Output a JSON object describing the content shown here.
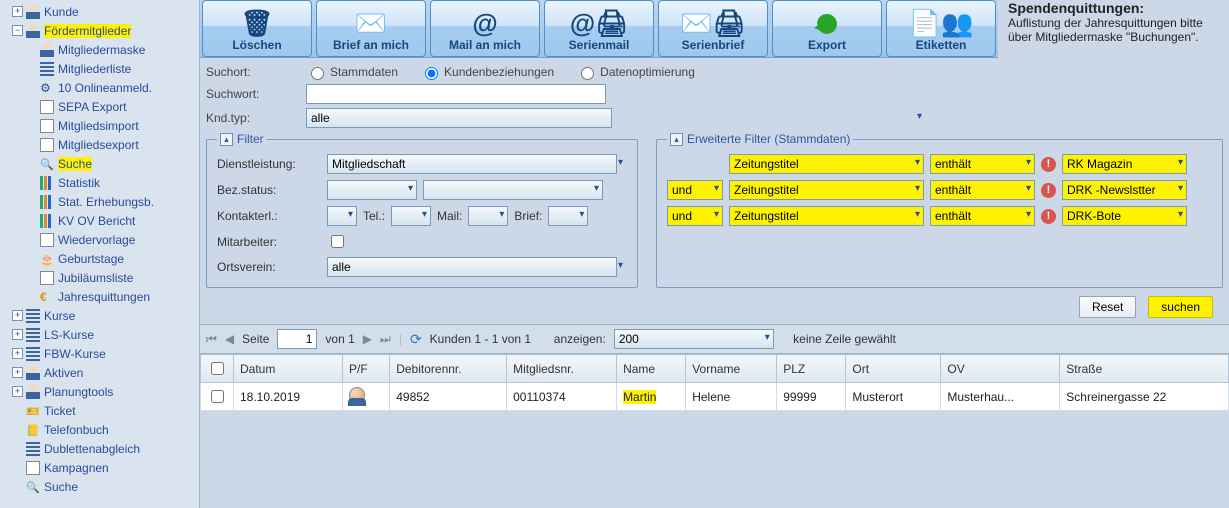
{
  "sidebar": {
    "items": [
      {
        "plus": "+",
        "icon": "person",
        "label": "Kunde",
        "level": 1,
        "name": "kunde"
      },
      {
        "plus": "−",
        "icon": "person",
        "label": "Fördermitglieder",
        "level": 1,
        "hl": true,
        "name": "foerdermitglieder"
      },
      {
        "plus": "",
        "icon": "person",
        "label": "Mitgliedermaske",
        "level": 2,
        "name": "mitgliedermaske"
      },
      {
        "plus": "",
        "icon": "list",
        "label": "Mitgliederliste",
        "level": 2,
        "name": "mitgliederliste"
      },
      {
        "plus": "",
        "icon": "gear",
        "label": "10  Onlineanmeld.",
        "level": 2,
        "name": "onlineanmeld"
      },
      {
        "plus": "",
        "icon": "doc",
        "label": "SEPA Export",
        "level": 2,
        "name": "sepa-export"
      },
      {
        "plus": "",
        "icon": "doc",
        "label": "Mitgliedsimport",
        "level": 2,
        "name": "mitgliedsimport"
      },
      {
        "plus": "",
        "icon": "doc",
        "label": "Mitgliedsexport",
        "level": 2,
        "name": "mitgliedsexport"
      },
      {
        "plus": "",
        "icon": "search",
        "label": "Suche",
        "level": 2,
        "hl": true,
        "name": "suche"
      },
      {
        "plus": "",
        "icon": "bars",
        "label": "Statistik",
        "level": 2,
        "name": "statistik"
      },
      {
        "plus": "",
        "icon": "bars",
        "label": "Stat. Erhebungsb.",
        "level": 2,
        "name": "stat-erhebungsb"
      },
      {
        "plus": "",
        "icon": "bars",
        "label": "KV OV Bericht",
        "level": 2,
        "name": "kv-ov-bericht"
      },
      {
        "plus": "",
        "icon": "doc",
        "label": "Wiedervorlage",
        "level": 2,
        "name": "wiedervorlage"
      },
      {
        "plus": "",
        "icon": "cake",
        "label": "Geburtstage",
        "level": 2,
        "name": "geburtstage"
      },
      {
        "plus": "",
        "icon": "doc",
        "label": "Jubiläumsliste",
        "level": 2,
        "name": "jubilaeumsliste"
      },
      {
        "plus": "",
        "icon": "euro",
        "label": "Jahresquittungen",
        "level": 2,
        "name": "jahresquittungen"
      },
      {
        "plus": "+",
        "icon": "list",
        "label": "Kurse",
        "level": 1,
        "name": "kurse"
      },
      {
        "plus": "+",
        "icon": "list",
        "label": "LS-Kurse",
        "level": 1,
        "name": "ls-kurse"
      },
      {
        "plus": "+",
        "icon": "list",
        "label": "FBW-Kurse",
        "level": 1,
        "name": "fbw-kurse"
      },
      {
        "plus": "+",
        "icon": "person",
        "label": "Aktiven",
        "level": 1,
        "name": "aktiven"
      },
      {
        "plus": "+",
        "icon": "person",
        "label": "Planungtools",
        "level": 1,
        "name": "planungtools"
      },
      {
        "plus": "",
        "icon": "ticket",
        "label": "Ticket",
        "level": 1,
        "name": "ticket"
      },
      {
        "plus": "",
        "icon": "phone",
        "label": "Telefonbuch",
        "level": 1,
        "name": "telefonbuch"
      },
      {
        "plus": "",
        "icon": "list",
        "label": "Dublettenabgleich",
        "level": 1,
        "name": "dublettenabgleich"
      },
      {
        "plus": "",
        "icon": "doc",
        "label": "Kampagnen",
        "level": 1,
        "name": "kampagnen"
      },
      {
        "plus": "",
        "icon": "search",
        "label": "Suche",
        "level": 1,
        "name": "global-suche"
      }
    ]
  },
  "toolbar": {
    "buttons": [
      {
        "label": "Löschen",
        "icon": "🗑",
        "name": "delete"
      },
      {
        "label": "Brief an mich",
        "icon": "✉️",
        "name": "brief-an-mich"
      },
      {
        "label": "Mail an mich",
        "icon": "@",
        "name": "mail-an-mich"
      },
      {
        "label": "Serienmail",
        "icon": "@🖨",
        "name": "serienmail"
      },
      {
        "label": "Serienbrief",
        "icon": "✉️🖨",
        "name": "serienbrief"
      },
      {
        "label": "Export",
        "icon": "↪",
        "name": "export",
        "green": true
      },
      {
        "label": "Etiketten",
        "icon": "📄👥",
        "name": "etiketten"
      }
    ]
  },
  "notice": {
    "title": "Spendenquittungen:",
    "body": "Auflistung der Jahresquittungen bitte über Mitgliedermaske \"Buchungen\"."
  },
  "search": {
    "suchort_label": "Suchort:",
    "suchwort_label": "Suchwort:",
    "kndtyp_label": "Knd.typ:",
    "kndtyp_value": "alle",
    "radios": [
      {
        "label": "Stammdaten",
        "checked": false
      },
      {
        "label": "Kundenbeziehungen",
        "checked": true
      },
      {
        "label": "Datenoptimierung",
        "checked": false
      }
    ]
  },
  "filter": {
    "legend": "Filter",
    "dienstleistung_label": "Dienstleistung:",
    "dienstleistung_value": "Mitgliedschaft",
    "bezstatus_label": "Bez.status:",
    "kontakterl_label": "Kontakterl.:",
    "tel_label": "Tel.:",
    "mail_label": "Mail:",
    "brief_label": "Brief:",
    "mitarbeiter_label": "Mitarbeiter:",
    "ortsverein_label": "Ortsverein:",
    "ortsverein_value": "alle"
  },
  "ext_filter": {
    "legend": "Erweiterte Filter (Stammdaten)",
    "rows": [
      {
        "and": "",
        "field": "Zeitungstitel",
        "op": "enthält",
        "value": "RK Magazin"
      },
      {
        "and": "und",
        "field": "Zeitungstitel",
        "op": "enthält",
        "value": "DRK -Newslstter"
      },
      {
        "and": "und",
        "field": "Zeitungstitel",
        "op": "enthält",
        "value": "DRK-Bote"
      }
    ]
  },
  "buttons": {
    "reset": "Reset",
    "search": "suchen"
  },
  "pager": {
    "seite_label": "Seite",
    "page": "1",
    "von_label": "von 1",
    "summary": "Kunden 1 - 1 von 1",
    "anzeigen_label": "anzeigen:",
    "page_size": "200",
    "no_row": "keine Zeile gewählt"
  },
  "table": {
    "headers": [
      "",
      "Datum",
      "P/F",
      "Debitorennr.",
      "Mitgliedsnr.",
      "Name",
      "Vorname",
      "PLZ",
      "Ort",
      "OV",
      "Straße"
    ],
    "rows": [
      {
        "datum": "18.10.2019",
        "pf": "person",
        "debitor": "49852",
        "mitglied": "00110374",
        "name": "Martin",
        "name_hl": true,
        "vorname": "Helene",
        "plz": "99999",
        "ort": "Musterort",
        "ov": "Musterhau...",
        "strasse": "Schreinergasse 22"
      }
    ]
  }
}
